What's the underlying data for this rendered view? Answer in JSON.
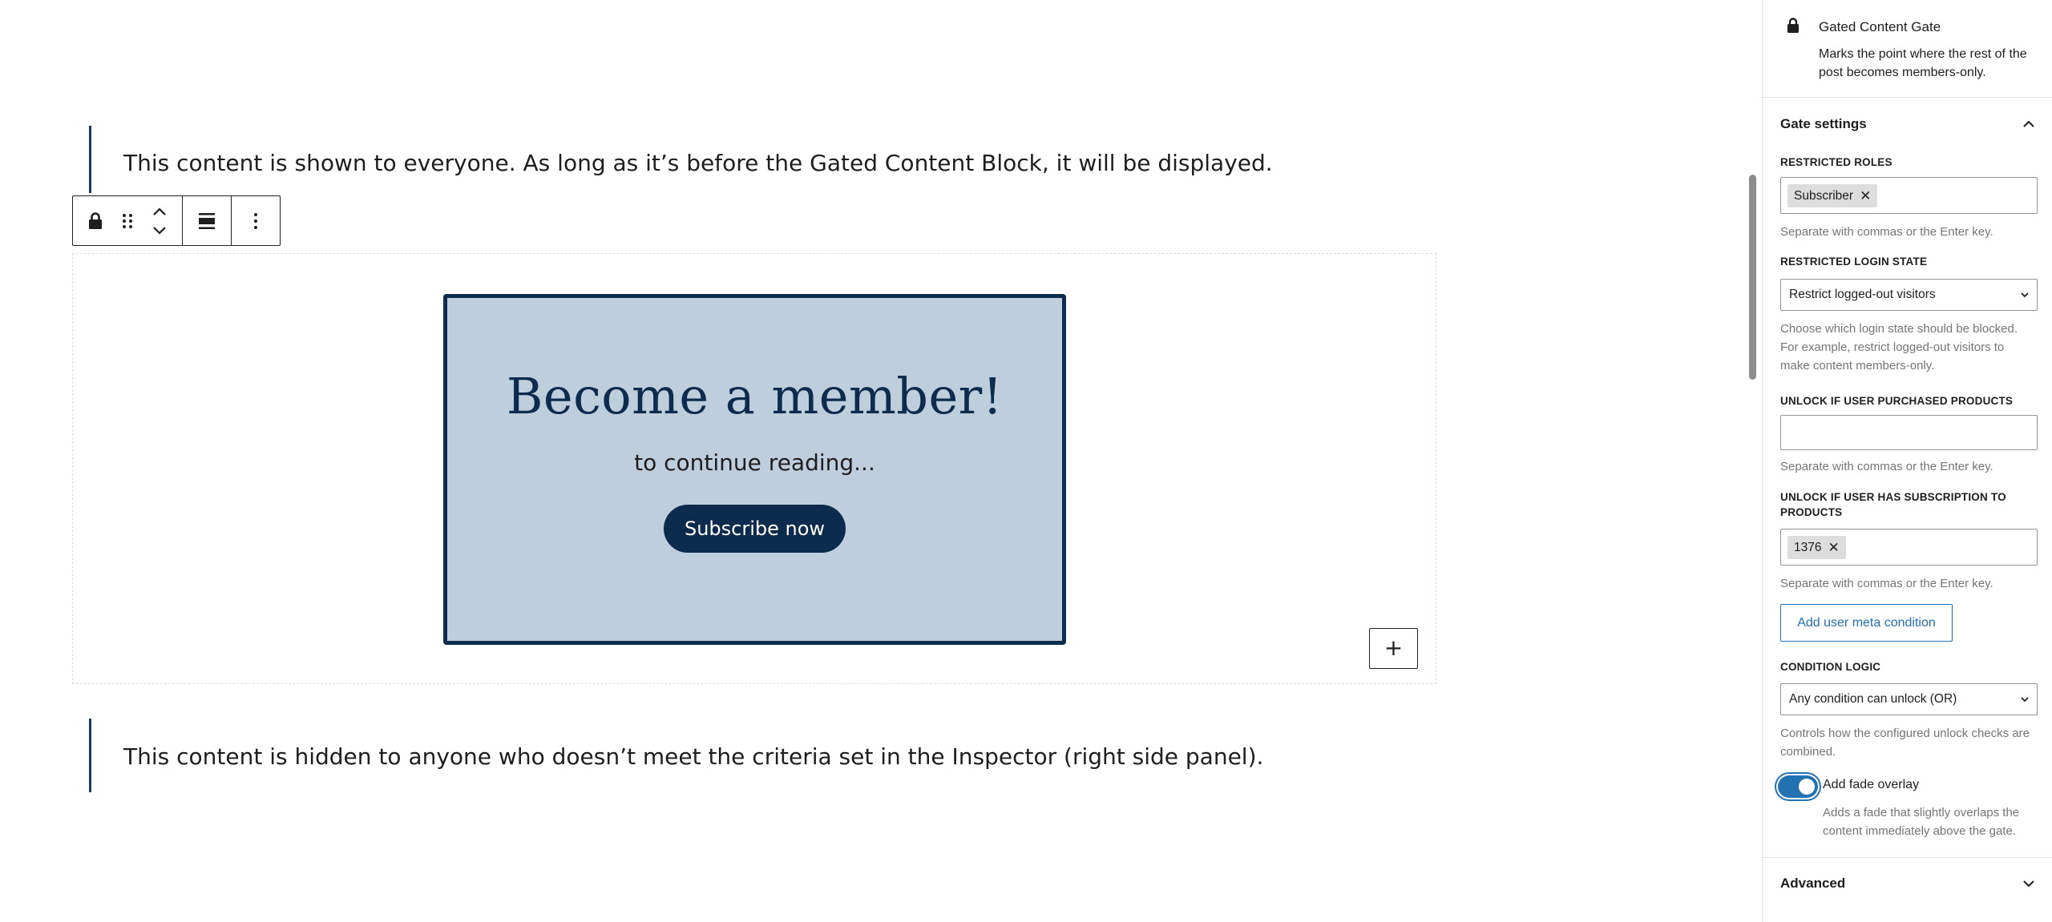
{
  "editor": {
    "paragraph_top": "This content is shown to everyone. As long as it’s before the Gated Content Block, it will be displayed.",
    "paragraph_bottom": "This content is hidden to anyone who doesn’t meet the criteria set in the Inspector (right side panel).",
    "card": {
      "title": "Become a member!",
      "subtitle": "to continue reading...",
      "button_label": "Subscribe now"
    },
    "add_block_label": "+"
  },
  "sidebar": {
    "block_title": "Gated Content Gate",
    "block_description": "Marks the point where the rest of the post becomes members-only.",
    "panel_title": "Gate settings",
    "restricted_roles": {
      "label": "RESTRICTED ROLES",
      "tokens": [
        "Subscriber"
      ],
      "help": "Separate with commas or the Enter key."
    },
    "login_state": {
      "label": "RESTRICTED LOGIN STATE",
      "selected": "Restrict logged-out visitors",
      "help": "Choose which login state should be blocked. For example, restrict logged-out visitors to make content members-only."
    },
    "purchased_products": {
      "label": "UNLOCK IF USER PURCHASED PRODUCTS",
      "help": "Separate with commas or the Enter key."
    },
    "subscription_products": {
      "label": "UNLOCK IF USER HAS SUBSCRIPTION TO PRODUCTS",
      "tokens": [
        "1376"
      ],
      "help": "Separate with commas or the Enter key."
    },
    "add_meta_button": "Add user meta condition",
    "condition_logic": {
      "label": "CONDITION LOGIC",
      "selected": "Any condition can unlock (OR)",
      "help": "Controls how the configured unlock checks are combined."
    },
    "fade_overlay": {
      "label": "Add fade overlay",
      "enabled": true,
      "help": "Adds a fade that slightly overlaps the content immediately above the gate."
    },
    "advanced_title": "Advanced"
  },
  "colors": {
    "accent": "#2271b1",
    "card_bg": "#bfcedd",
    "card_border": "#0c2b4d",
    "quote_border": "#1c3a5e"
  }
}
